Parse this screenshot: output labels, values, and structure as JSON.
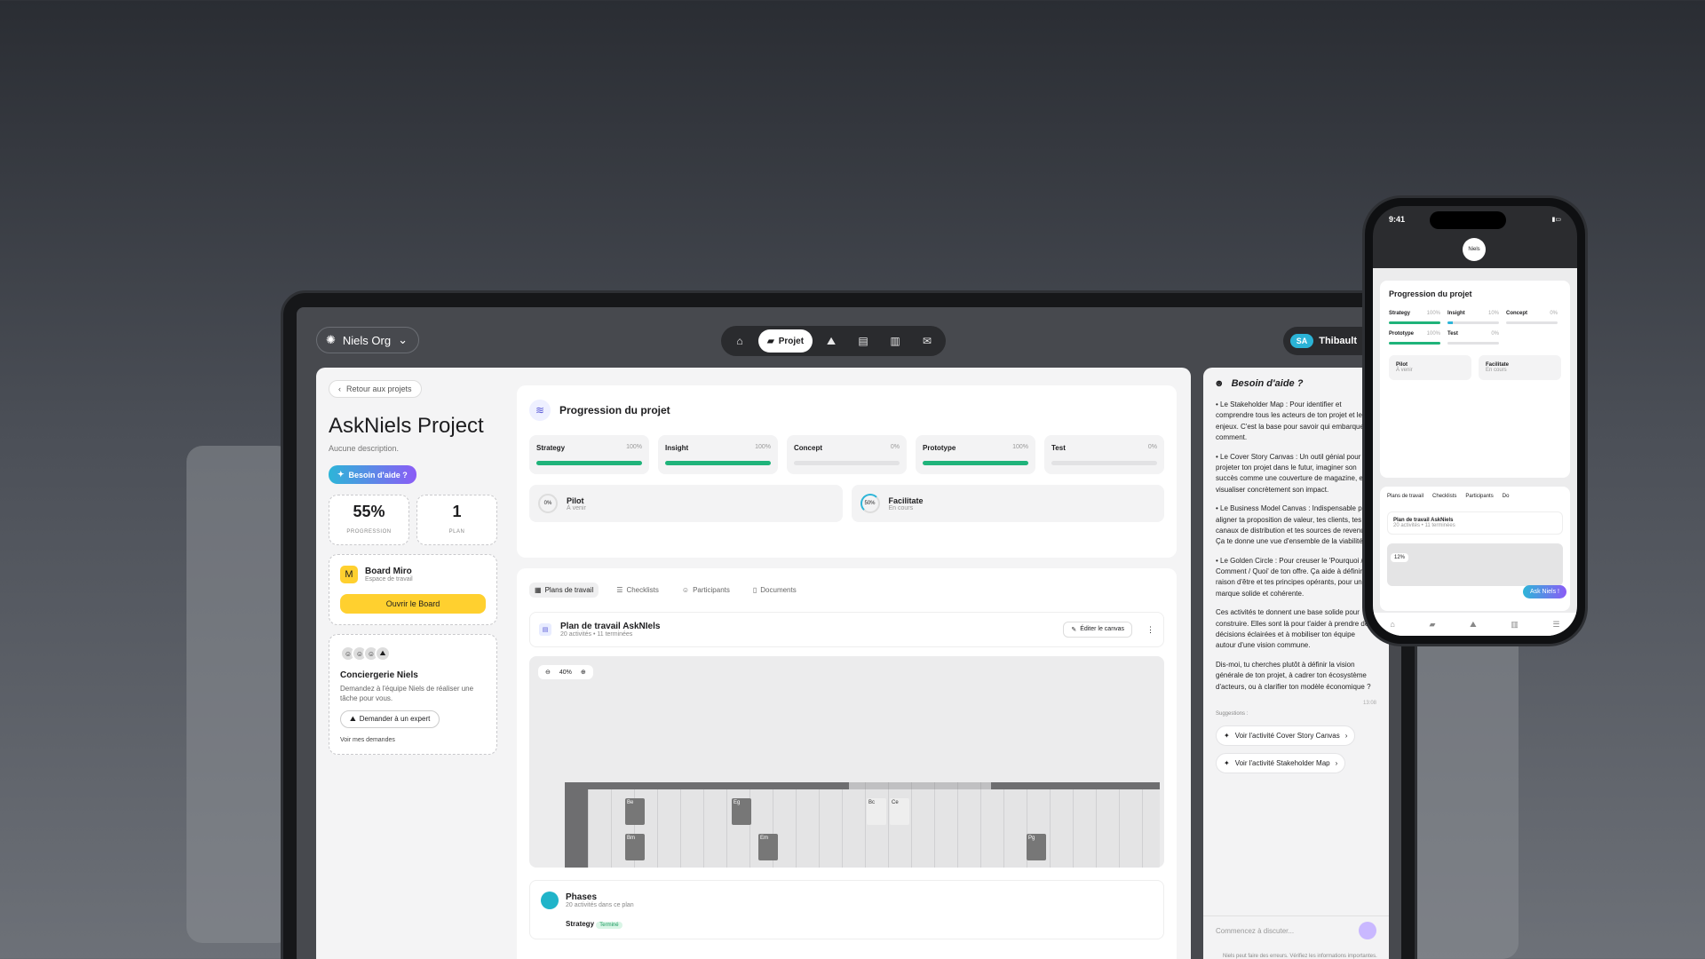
{
  "org": {
    "name": "Niels Org"
  },
  "nav": {
    "items": [
      "home",
      "projet",
      "concierge",
      "box",
      "library",
      "inbox"
    ],
    "active_label": "Projet"
  },
  "user": {
    "badge": "SA",
    "name": "Thibault",
    "initials": "TD"
  },
  "sidebar": {
    "back": "Retour aux projets",
    "title": "AskNiels Project",
    "desc": "Aucune description.",
    "help": "Besoin d'aide ?",
    "stats": [
      {
        "value": "55%",
        "label": "PROGRESSION"
      },
      {
        "value": "1",
        "label": "PLAN"
      }
    ],
    "miro": {
      "title": "Board Miro",
      "sub": "Espace de travail",
      "button": "Ouvrir le Board"
    },
    "concierge": {
      "title": "Conciergerie Niels",
      "desc": "Demandez à l'équipe Niels de réaliser une tâche pour vous.",
      "button": "Demander à un expert",
      "link": "Voir mes demandes"
    }
  },
  "progress": {
    "title": "Progression du projet",
    "phases": [
      {
        "name": "Strategy",
        "pct": "100%",
        "value": 1
      },
      {
        "name": "Insight",
        "pct": "100%",
        "value": 1
      },
      {
        "name": "Concept",
        "pct": "0%",
        "value": 0
      },
      {
        "name": "Prototype",
        "pct": "100%",
        "value": 1
      },
      {
        "name": "Test",
        "pct": "0%",
        "value": 0
      }
    ],
    "steps": [
      {
        "name": "Pilot",
        "status": "À venir",
        "pct": "0%"
      },
      {
        "name": "Facilitate",
        "status": "En cours",
        "pct": "50%"
      }
    ]
  },
  "plans": {
    "tabs": [
      "Plans de travail",
      "Checklists",
      "Participants",
      "Documents"
    ],
    "plan_title": "Plan de travail AskNIels",
    "plan_sub": "20 activités • 11 terminées",
    "edit": "Éditer le canvas",
    "zoom": "40%",
    "phases_title": "Phases",
    "phases_sub": "20 activités dans ce plan",
    "first_phase": "Strategy",
    "first_status": "Terminé",
    "cells": [
      "Be",
      "Eg",
      "Bc",
      "Ce",
      "Bm",
      "Em",
      "Pg"
    ]
  },
  "chat": {
    "title": "Besoin d'aide ?",
    "messages": [
      "• Le Stakeholder Map : Pour identifier et comprendre tous les acteurs de ton projet et leurs enjeux. C'est la base pour savoir qui embarquer et comment.",
      "• Le Cover Story Canvas : Un outil génial pour projeter ton projet dans le futur, imaginer son succès comme une couverture de magazine, et visualiser concrètement son impact.",
      "• Le Business Model Canvas : Indispensable pour aligner ta proposition de valeur, tes clients, tes canaux de distribution et tes sources de revenus. Ça te donne une vue d'ensemble de la viabilité.",
      "• Le Golden Circle : Pour creuser le 'Pourquoi / Comment / Quoi' de ton offre. Ça aide à définir ta raison d'être et tes principes opérants, pour une marque solide et cohérente.",
      "Ces activités te donnent une base solide pour construire. Elles sont là pour t'aider à prendre des décisions éclairées et à mobiliser ton équipe autour d'une vision commune.",
      "Dis-moi, tu cherches plutôt à définir la vision générale de ton projet, à cadrer ton écosystème d'acteurs, ou à clarifier ton modèle économique ?"
    ],
    "time": "13:08",
    "suggestions_label": "Suggestions :",
    "suggestions": [
      "Voir l'activité Cover Story Canvas",
      "Voir l'activité Stakeholder Map"
    ],
    "placeholder": "Commencez à discuter...",
    "disclaimer": "Niels peut faire des erreurs. Vérifiez les informations importantes."
  },
  "phone": {
    "time": "9:41",
    "logo": "Niels",
    "title": "Progression du projet",
    "phases": [
      {
        "name": "Strategy",
        "pct": "100%"
      },
      {
        "name": "Insight",
        "pct": "10%"
      },
      {
        "name": "Concept",
        "pct": "0%"
      },
      {
        "name": "Prototype",
        "pct": "100%"
      },
      {
        "name": "Test",
        "pct": "0%"
      }
    ],
    "steps": [
      {
        "name": "Pilot",
        "status": "À venir"
      },
      {
        "name": "Facilitate",
        "status": "En cours"
      }
    ],
    "tabs": [
      "Plans de travail",
      "Checklists",
      "Participants",
      "Do"
    ],
    "plan": "Plan de travail AskNiels",
    "plan_sub": "20 activités • 11 terminées",
    "zoom": "12%",
    "ask": "Ask Niels !",
    "nav": [
      "Accueil",
      "Projets",
      "Conciergerie",
      "Bibliothèque",
      "Menu"
    ]
  }
}
